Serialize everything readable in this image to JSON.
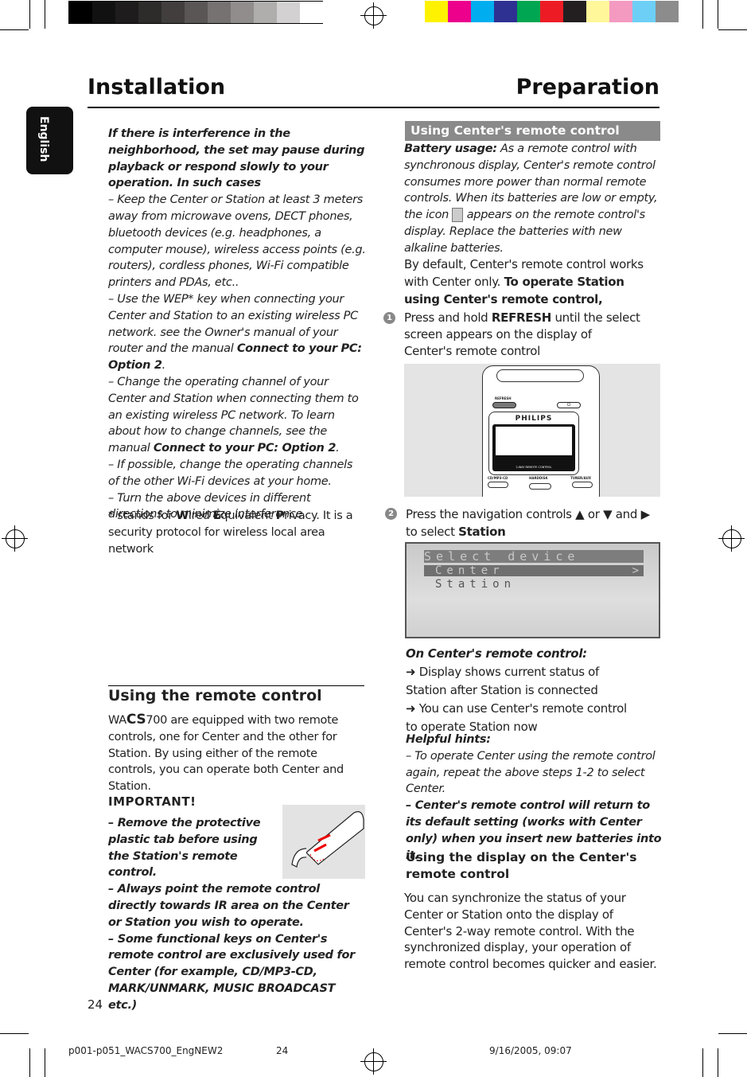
{
  "colorbar": {
    "grays": [
      "#000000",
      "#111111",
      "#1e1c1c",
      "#2e2b2b",
      "#423e3e",
      "#5a5656",
      "#767272",
      "#918d8d",
      "#b0adad",
      "#d3d1d1",
      "#ffffff"
    ],
    "colors": [
      "#fff200",
      "#ec008c",
      "#00aeef",
      "#2e3192",
      "#00a651",
      "#ed1c24",
      "#231f20",
      "#fff799",
      "#f49ac1",
      "#6dcff6",
      "#8c8c8c"
    ]
  },
  "header": {
    "left": "Installation",
    "right": "Preparation"
  },
  "language_tab": "English",
  "left": {
    "interference": {
      "heading": "If there is interference in the neighborhood, the set may pause during playback or respond slowly to your operation. In such cases",
      "b1": "–   Keep the Center or Station at least 3 meters away from microwave ovens, DECT phones, bluetooth devices (e.g. headphones, a computer mouse), wireless access points (e.g. routers), cordless phones, Wi-Fi compatible printers and PDAs, etc..",
      "b2a": "–   Use the WEP* key when connecting your Center and Station to an existing wireless  PC network. see the Owner's manual of your router and the manual ",
      "b2b": "Connect to your PC: Option 2",
      "b2c": ".",
      "b3a": "–   Change the operating channel of your Center and Station when connecting them to an existing wireless PC network. To learn about how to change channels, see the manual ",
      "b3b": "Connect to your PC: Option 2",
      "b3c": ".",
      "b4": "–   If possible, change the operating channels of the other Wi-Fi devices at your home.",
      "b5": "–   Turn the above devices in different directions to minimize interference."
    },
    "wep": {
      "a": "* stands for ",
      "w": "W",
      "b": "ired ",
      "e": "E",
      "c": "quivalent ",
      "p": "P",
      "d": "rivacy. It is a security protocol for wireless local area network"
    },
    "remote": {
      "title": "Using the remote control",
      "intro_a": "WA",
      "intro_b": "CS",
      "intro_c": "700 are equipped with two remote controls, one for Center and the other for Station. By using either of the remote controls, you can operate both Center and Station.",
      "important": "IMPORTANT!",
      "i1": "–   Remove the protective plastic tab before using the Station's remote control.",
      "i2": "–   Always point the remote control directly towards IR area on the Center or Station you wish to operate.",
      "i3": "–   Some functional keys on Center's remote control are exclusively used for Center (for example, CD/MP3-CD, MARK/UNMARK, MUSIC BROADCAST etc.)"
    }
  },
  "right": {
    "section_bar": "Using Center's remote control",
    "battery_label": "Battery usage:",
    "battery_text_a": " As a remote control with synchronous display, Center's remote control consumes more power than normal remote controls. When its batteries are low or empty, the icon ",
    "battery_text_b": " appears on the remote control's display. Replace the batteries with new alkaline batteries.",
    "default_a": "By default, Center's remote control works with Center only. ",
    "default_b": "To operate Station using Center's remote control,",
    "step1": {
      "num": "1",
      "a": "Press and hold ",
      "b": "REFRESH",
      "c": " until the select screen appears on the display of Center's remote control"
    },
    "remote_image": {
      "refresh": "REFRESH",
      "brand": "PHILIPS",
      "label": "2-WAY REMOTE CONTROL",
      "k1": "CD/MP3-CD",
      "k2": "HARDDISK",
      "k3": "TUNER/AUX"
    },
    "step2": {
      "num": "2",
      "a": "Press the navigation controls ▲  or  ▼  and ▶",
      "b": " to select ",
      "c": "Station"
    },
    "lcd": {
      "title": "Select device",
      "item1": "Center",
      "item2": "Station",
      "arrow": ">"
    },
    "on_center": "On Center's remote control:",
    "r1": "➜ Display shows current status of Station after Station is connected",
    "r2": "➜ You can use Center's remote control to operate Station now",
    "hints": "Helpful hints:",
    "h1": "–   To operate Center using the remote control again, repeat the above steps 1-2 to select Center.",
    "h2": "–   Center's remote control will return to its default setting (works with Center only) when you insert new batteries into it.",
    "display_title": "Using the display on the Center's remote control",
    "display_text": "You can synchronize the status of your Center or Station onto the display of Center's 2-way remote control. With the synchronized display, your operation of remote control becomes quicker and easier."
  },
  "page_number": "24",
  "footer": {
    "file": "p001-p051_WACS700_EngNEW2",
    "page": "24",
    "date": "9/16/2005, 09:07"
  }
}
